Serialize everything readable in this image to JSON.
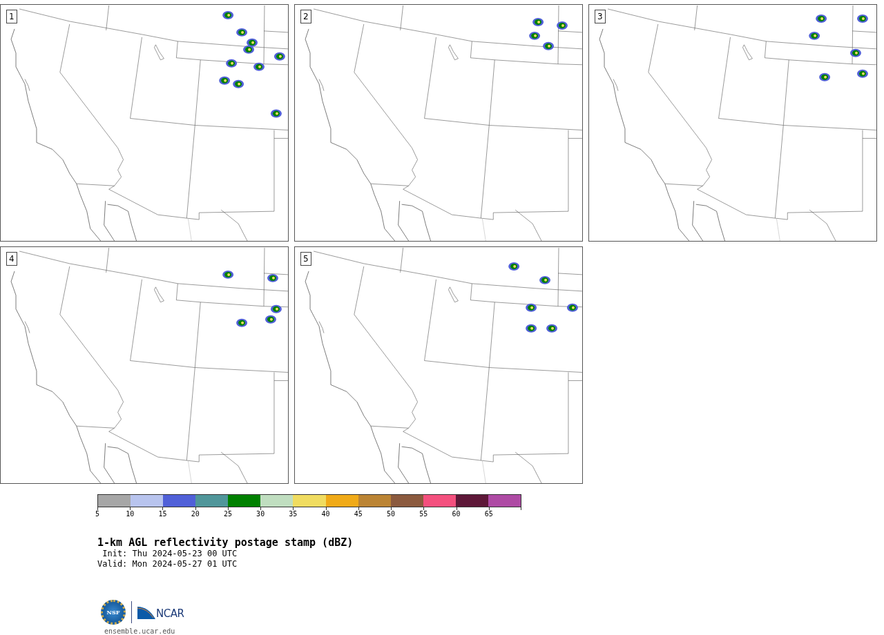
{
  "panels": [
    {
      "label": "1"
    },
    {
      "label": "2"
    },
    {
      "label": "3"
    },
    {
      "label": "4"
    },
    {
      "label": "5"
    }
  ],
  "colorbar": {
    "segments": [
      {
        "color": "#a6a6a6"
      },
      {
        "color": "#b8c4ee"
      },
      {
        "color": "#5060d8"
      },
      {
        "color": "#50969a"
      },
      {
        "color": "#008000"
      },
      {
        "color": "#c0dec0"
      },
      {
        "color": "#f0dc60"
      },
      {
        "color": "#f0aa18"
      },
      {
        "color": "#bb8434"
      },
      {
        "color": "#8b5a3e"
      },
      {
        "color": "#f4507e"
      },
      {
        "color": "#5e1838"
      },
      {
        "color": "#ae4aa4"
      }
    ],
    "ticks": [
      "5",
      "10",
      "15",
      "20",
      "25",
      "30",
      "35",
      "40",
      "45",
      "50",
      "55",
      "60",
      "65"
    ]
  },
  "title": "1-km AGL reflectivity postage stamp (dBZ)",
  "init": " Init: Thu 2024-05-23 00 UTC",
  "valid": "Valid: Mon 2024-05-27 01 UTC",
  "logos": {
    "nsf": "NSF",
    "ncar": "NCAR"
  },
  "url": "ensemble.ucar.edu"
}
